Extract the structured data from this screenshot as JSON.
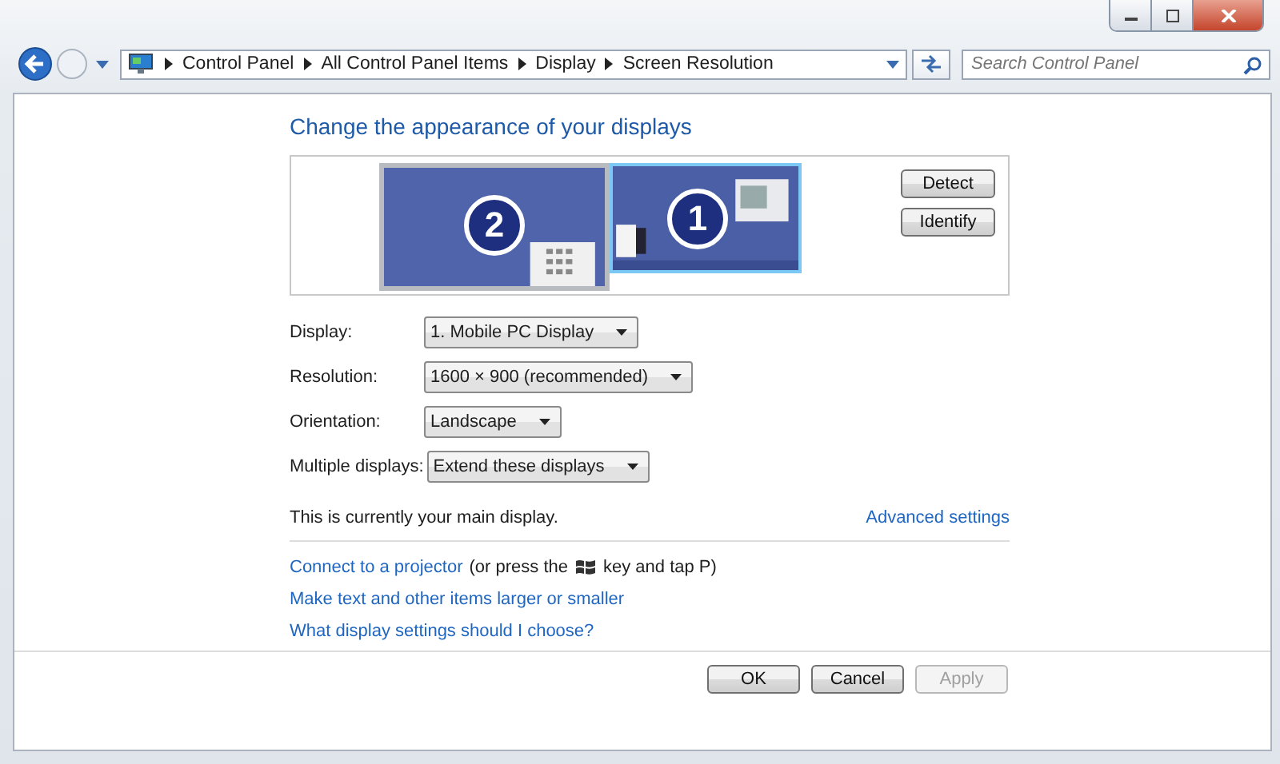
{
  "address_bar": {
    "crumbs": [
      "Control Panel",
      "All Control Panel Items",
      "Display",
      "Screen Resolution"
    ],
    "search_placeholder": "Search Control Panel"
  },
  "heading": "Change the appearance of your displays",
  "monitors": [
    {
      "number": "2",
      "selected": false
    },
    {
      "number": "1",
      "selected": true
    }
  ],
  "side_buttons": [
    "Detect",
    "Identify"
  ],
  "settings": [
    {
      "label": "Display:",
      "value": "1. Mobile PC Display"
    },
    {
      "label": "Resolution:",
      "value": "1600 × 900 (recommended)"
    },
    {
      "label": "Orientation:",
      "value": "Landscape"
    },
    {
      "label": "Multiple displays:",
      "value": "Extend these displays"
    }
  ],
  "main_display_note": "This is currently your main display.",
  "advanced_link": "Advanced settings",
  "projector": {
    "link": "Connect to a projector",
    "before_key": "(or press the",
    "after_key": "key and tap P)"
  },
  "links": [
    "Make text and other items larger or smaller",
    "What display settings should I choose?"
  ],
  "buttons": [
    {
      "label": "OK",
      "disabled": false
    },
    {
      "label": "Cancel",
      "disabled": false
    },
    {
      "label": "Apply",
      "disabled": true
    }
  ]
}
